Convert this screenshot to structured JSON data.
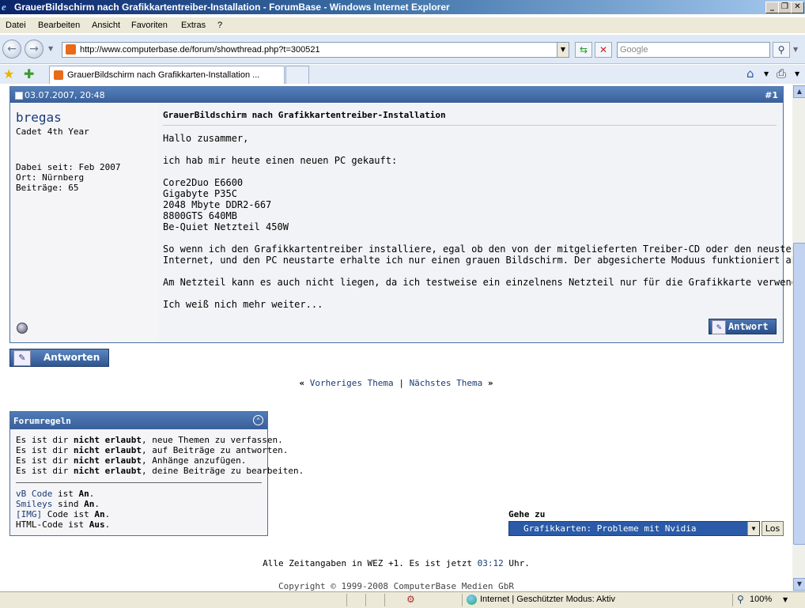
{
  "window": {
    "title": "GrauerBildschirm nach Grafikkartentreiber-Installation - ForumBase - Windows Internet Explorer"
  },
  "menu": [
    "Datei",
    "Bearbeiten",
    "Ansicht",
    "Favoriten",
    "Extras",
    "?"
  ],
  "nav": {
    "url": "http://www.computerbase.de/forum/showthread.php?t=300521",
    "search_placeholder": "Google"
  },
  "tab": {
    "title": "GrauerBildschirm nach Grafikkarten-Installation ..."
  },
  "post": {
    "date": "03.07.2007, 20:48",
    "number": "#1",
    "user": {
      "name": "bregas",
      "title": "Cadet 4th Year",
      "joined": "Dabei seit: Feb 2007",
      "location": "Ort: Nürnberg",
      "posts": "Beiträge: 65"
    },
    "title": "GrauerBildschirm nach Grafikkartentreiber-Installation",
    "lines": [
      "Hallo zusammer,",
      "ich hab mir heute einen neuen PC gekauft:",
      "Core2Duo E6600",
      "Gigabyte P35C",
      "2048 Mbyte DDR2-667",
      "8800GTS 640MB",
      "Be-Quiet Netzteil 450W",
      "So wenn ich den Grafikkartentreiber installiere, egal ob den von der mitgelieferten Treiber-CD oder den neusten aus dem",
      "Internet, und den PC neustarte erhalte ich nur einen grauen Bildschirm. Der abgesicherte Moduus funktioniert aber...",
      "Am Netzteil kann es auch nicht liegen, da ich testweise ein einzelnens Netzteil nur für die Grafikkarte verwendet habe..",
      "Ich weiß nich mehr weiter..."
    ],
    "reply_label": "Antwort"
  },
  "reply_button": "Antworten",
  "thread_nav": {
    "prev": "Vorheriges Thema",
    "sep": "|",
    "next": "Nächstes Thema",
    "left_quote": "«",
    "right_quote": "»"
  },
  "rules": {
    "title": "Forumregeln",
    "lines": [
      {
        "a": "Es ist dir ",
        "b": "nicht erlaubt",
        "c": ", neue Themen zu verfassen."
      },
      {
        "a": "Es ist dir ",
        "b": "nicht erlaubt",
        "c": ", auf Beiträge zu antworten."
      },
      {
        "a": "Es ist dir ",
        "b": "nicht erlaubt",
        "c": ", Anhänge anzufügen."
      },
      {
        "a": "Es ist dir ",
        "b": "nicht erlaubt",
        "c": ", deine Beiträge zu bearbeiten."
      }
    ],
    "codes": [
      {
        "link": "vB Code",
        "mid": " ist ",
        "val": "An",
        "end": "."
      },
      {
        "link": "Smileys",
        "mid": " sind ",
        "val": "An",
        "end": "."
      },
      {
        "link": "[IMG]",
        "mid": " Code ist ",
        "val": "An",
        "end": "."
      },
      {
        "link": "",
        "mid": "HTML-Code ist ",
        "val": "Aus",
        "end": "."
      }
    ]
  },
  "goto": {
    "label": "Gehe zu",
    "selected": "Grafikkarten: Probleme mit Nvidia",
    "button": "Los"
  },
  "footer": {
    "time_prefix": "Alle Zeitangaben in WEZ +1. Es ist jetzt",
    "clock": "03:12",
    "time_suffix": "Uhr.",
    "copyright": "Copyright © 1999-2008 ComputerBase Medien GbR"
  },
  "status": {
    "zone": "Internet | Geschützter Modus: Aktiv",
    "zoom": "100%"
  },
  "colors": {
    "accent": "#3a5f9a",
    "link": "#1a3a78",
    "titlebar": "#0a246a"
  }
}
